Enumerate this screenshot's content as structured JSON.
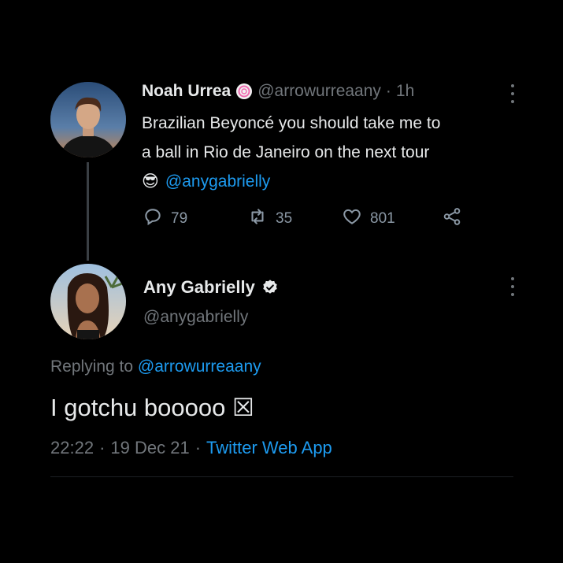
{
  "tweet": {
    "author_name": "Noah Urrea",
    "handle": "@arrowurreaany",
    "separator": "·",
    "time": "1h",
    "text_line1": "Brazilian Beyoncé you should take me to",
    "text_line2": "a ball in Rio de Janeiro on the next tour",
    "emoji": "😎",
    "mention": "@anygabrielly",
    "replies": "79",
    "retweets": "35",
    "likes": "801"
  },
  "reply": {
    "author_name": "Any Gabrielly",
    "handle": "@anygabrielly",
    "replying_prefix": "Replying to",
    "replying_handle": "@arrowurreaany",
    "text": "I gotchu booooo ☒",
    "time": "22:22",
    "separator": "·",
    "date": "19 Dec 21",
    "source": "Twitter Web App"
  },
  "colors": {
    "background": "#000000",
    "text": "#e7e9ea",
    "muted": "#71767b",
    "link": "#1d9bf0"
  }
}
